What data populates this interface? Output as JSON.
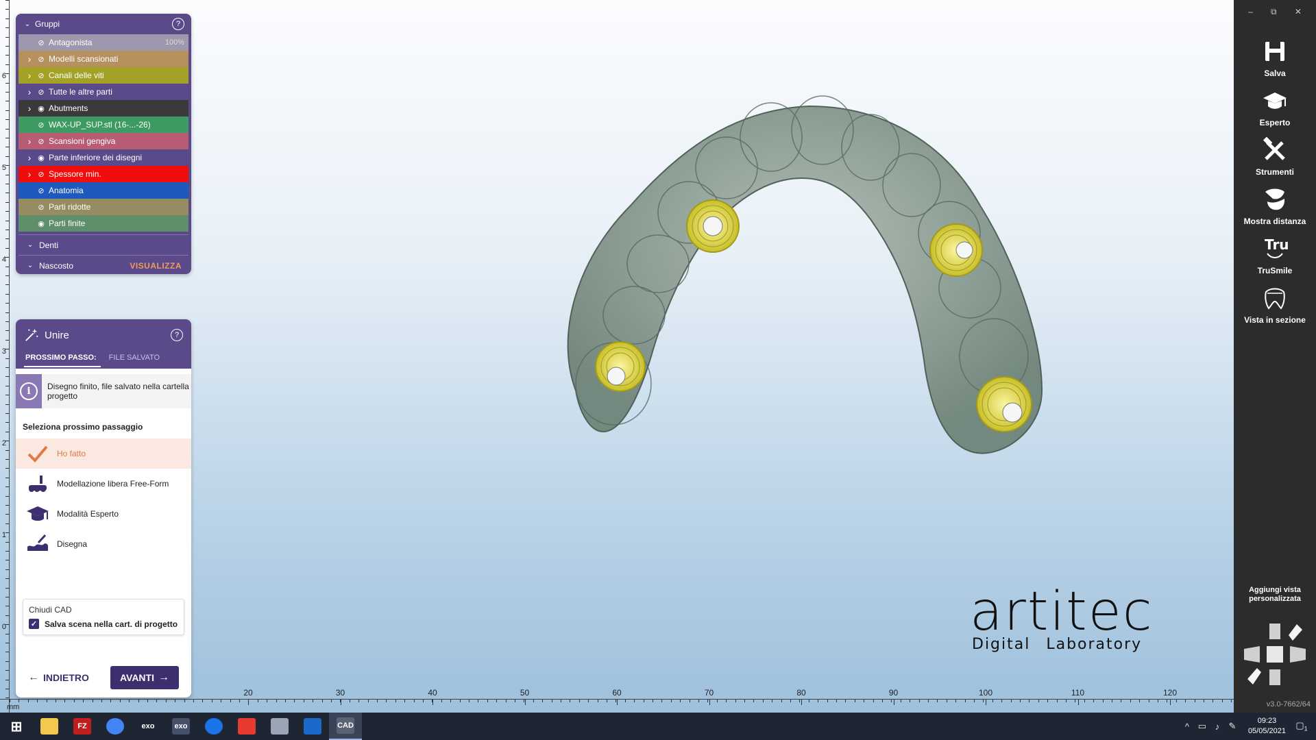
{
  "groups_panel": {
    "title": "Gruppi",
    "help": "?",
    "rows": [
      {
        "label": "Antagonista",
        "color": "#9d98ad",
        "expand": false,
        "visible": false,
        "extra": "100%"
      },
      {
        "label": "Modelli scansionati",
        "color": "#b79060",
        "expand": true,
        "visible": false,
        "extra": ""
      },
      {
        "label": "Canali delle viti",
        "color": "#a3a227",
        "expand": true,
        "visible": false,
        "extra": ""
      },
      {
        "label": "Tutte le altre parti",
        "color": "#5b4a8a",
        "expand": true,
        "visible": false,
        "extra": ""
      },
      {
        "label": "Abutments",
        "color": "#3a3a3a",
        "expand": true,
        "visible": true,
        "extra": ""
      },
      {
        "label": "WAX-UP_SUP.stl (16-...-26)",
        "color": "#3d9a62",
        "expand": false,
        "visible": false,
        "extra": ""
      },
      {
        "label": "Scansioni gengiva",
        "color": "#b75c72",
        "expand": true,
        "visible": false,
        "extra": ""
      },
      {
        "label": "Parte inferiore dei disegni",
        "color": "#5b4a8a",
        "expand": true,
        "visible": true,
        "extra": ""
      },
      {
        "label": "Spessore min.",
        "color": "#f20d0d",
        "expand": true,
        "visible": false,
        "extra": ""
      },
      {
        "label": "Anatomia",
        "color": "#1e59bd",
        "expand": false,
        "visible": false,
        "extra": ""
      },
      {
        "label": "Parti ridotte",
        "color": "#958c62",
        "expand": false,
        "visible": false,
        "extra": ""
      },
      {
        "label": "Parti finite",
        "color": "#5f8f6a",
        "expand": false,
        "visible": true,
        "extra": ""
      }
    ],
    "section_teeth": "Denti",
    "section_hidden": "Nascosto",
    "show_link": "VISUALIZZA"
  },
  "merge_panel": {
    "title": "Unire",
    "help": "?",
    "tabs": [
      {
        "label": "PROSSIMO PASSO:",
        "active": true
      },
      {
        "label": "FILE SALVATO",
        "active": false
      }
    ],
    "info_icon": "i",
    "info_text": "Disegno finito, file salvato nella cartella progetto",
    "next_step_label": "Seleziona prossimo passaggio",
    "steps": [
      {
        "label": "Ho fatto",
        "icon": "check-icon",
        "selected": true
      },
      {
        "label": "Modellazione libera Free-Form",
        "icon": "free-form-icon",
        "selected": false
      },
      {
        "label": "Modalità Esperto",
        "icon": "graduation-cap-icon",
        "selected": false
      },
      {
        "label": "Disegna",
        "icon": "design-brush-icon",
        "selected": false
      }
    ],
    "close_cad_title": "Chiudi CAD",
    "save_scene_label": "Salva scena nella cart. di progetto",
    "save_scene_checked": true,
    "back_label": "INDIETRO",
    "next_label": "AVANTI"
  },
  "toolbar": {
    "window_controls": [
      "–",
      "⧉",
      "✕"
    ],
    "tools": [
      {
        "label": "Salva",
        "icon": "save-icon"
      },
      {
        "label": "Esperto",
        "icon": "graduation-cap-icon"
      },
      {
        "label": "Strumenti",
        "icon": "tools-icon"
      },
      {
        "label": "Mostra distanza",
        "icon": "distance-icon"
      },
      {
        "label": "TruSmile",
        "icon": "trusmile-icon"
      },
      {
        "label": "Vista in sezione",
        "icon": "section-view-icon"
      }
    ],
    "add_view_line1": "Aggiungi vista",
    "add_view_line2": "personalizzata",
    "version": "v3.0-7662/64"
  },
  "viewport": {
    "ruler_unit": "mm",
    "bottom_ticks": [
      "20",
      "30",
      "40",
      "50",
      "60",
      "70",
      "80",
      "90",
      "100",
      "110",
      "120"
    ],
    "left_ticks": [
      "6",
      "5",
      "4",
      "3",
      "2",
      "1",
      "0"
    ],
    "logo_word": "artitec",
    "logo_sub": "Digital Laboratory"
  },
  "taskbar": {
    "apps": [
      {
        "name": "windows-start-icon",
        "label": "",
        "color": "#1e2533"
      },
      {
        "name": "file-explorer-icon",
        "label": "",
        "color": "#f2c94c"
      },
      {
        "name": "filezilla-icon",
        "label": "FZ",
        "color": "#bf1e1e"
      },
      {
        "name": "chrome-icon",
        "label": "",
        "color": "#4285f4"
      },
      {
        "name": "exocad-icon",
        "label": "exo",
        "color": "#1e2533"
      },
      {
        "name": "exocad-alt-icon",
        "label": "exo",
        "color": "#46506a"
      },
      {
        "name": "teamviewer-icon",
        "label": "",
        "color": "#1a73e8"
      },
      {
        "name": "anydesk-icon",
        "label": "",
        "color": "#e63b2e"
      },
      {
        "name": "brain-app-icon",
        "label": "",
        "color": "#9aa4b5"
      },
      {
        "name": "photos-icon",
        "label": "",
        "color": "#1b6ac9"
      },
      {
        "name": "cad-icon",
        "label": "CAD",
        "color": "#5a6275"
      }
    ],
    "time": "09:23",
    "date": "05/05/2021",
    "notification_count": "1"
  }
}
